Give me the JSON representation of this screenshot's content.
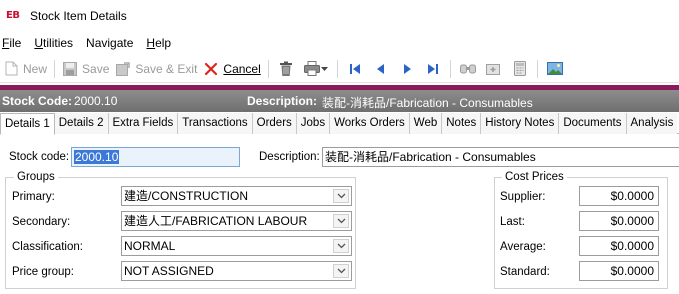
{
  "window": {
    "logo": "EB",
    "title": "Stock Item Details"
  },
  "menu": [
    {
      "first": "F",
      "rest": "ile"
    },
    {
      "first": "U",
      "rest": "tilities"
    },
    {
      "first": "",
      "rest": "Navigate"
    },
    {
      "first": "H",
      "rest": "elp"
    }
  ],
  "toolbar": {
    "new_label": "New",
    "save_label": "Save",
    "save_exit_label": "Save & Exit",
    "cancel_label": "Cancel"
  },
  "header": {
    "stock_code_label": "Stock Code:",
    "stock_code_value": "2000.10",
    "description_label": "Description:",
    "description_value": "装配-消耗品/Fabrication - Consumables"
  },
  "tabs": [
    "Details 1",
    "Details 2",
    "Extra Fields",
    "Transactions",
    "Orders",
    "Jobs",
    "Works Orders",
    "Web",
    "Notes",
    "History Notes",
    "Documents",
    "Analysis"
  ],
  "form": {
    "stock_code_label": "Stock code:",
    "stock_code_value": "2000.10",
    "description_label": "Description:",
    "description_value": "装配-消耗品/Fabrication - Consumables",
    "groups_title": "Groups",
    "primary_label": "Primary:",
    "primary_value": "建造/CONSTRUCTION",
    "secondary_label": "Secondary:",
    "secondary_value": "建造人工/FABRICATION LABOUR",
    "classification_label": "Classification:",
    "classification_value": "NORMAL",
    "price_group_label": "Price group:",
    "price_group_value": "NOT ASSIGNED",
    "cost_prices_title": "Cost Prices",
    "supplier_label": "Supplier:",
    "supplier_value": "$0.0000",
    "last_label": "Last:",
    "last_value": "$0.0000",
    "average_label": "Average:",
    "average_value": "$0.0000",
    "standard_label": "Standard:",
    "standard_value": "$0.0000"
  },
  "colors": {
    "accent_strip": "#8b1a5a",
    "header_bg": "#7d7d7d",
    "nav_blue": "#2b63c9",
    "cancel_red": "#d9261c"
  }
}
